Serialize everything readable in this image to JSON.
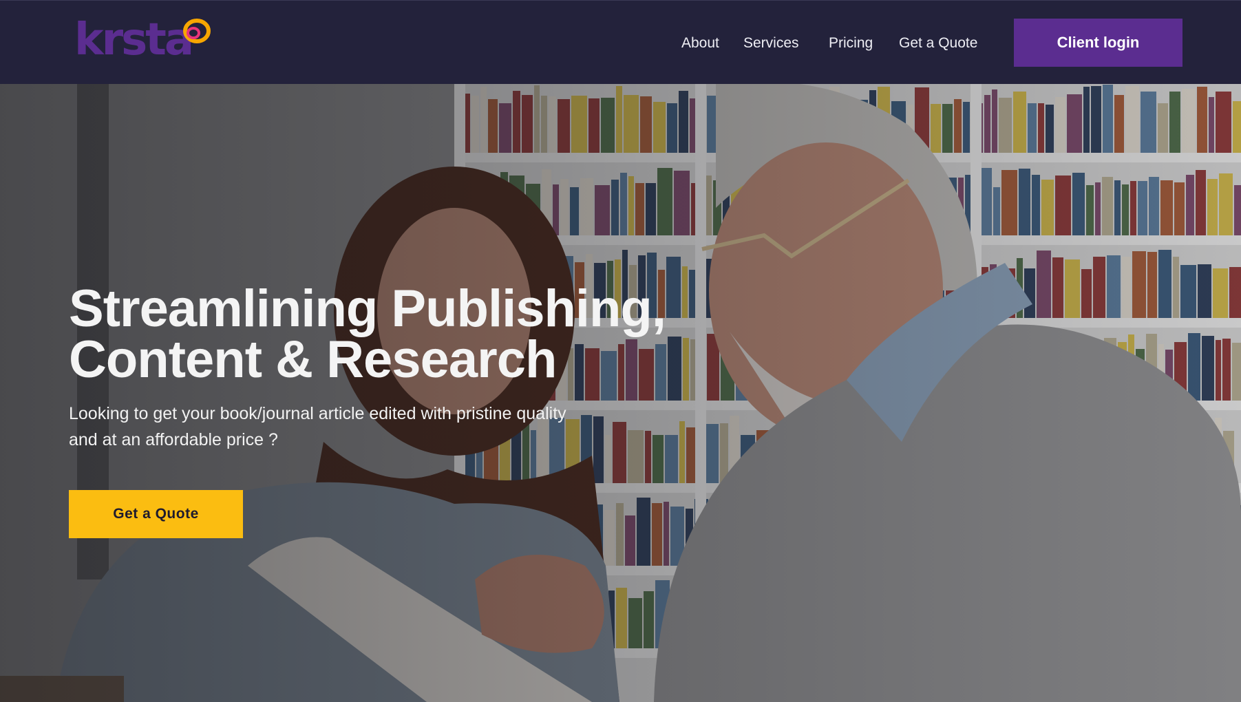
{
  "brand": {
    "name": "krsta",
    "colors": {
      "primary": "#5b2d90",
      "accent": "#fbbd11",
      "ring_outer": "#f7a600",
      "ring_inner": "#e9347a",
      "header_bg": "#23223b"
    }
  },
  "nav": {
    "items": [
      {
        "label": "About"
      },
      {
        "label": "Services"
      },
      {
        "label": "Pricing"
      },
      {
        "label": "Get a Quote"
      }
    ],
    "login_label": "Client login"
  },
  "hero": {
    "title_line1": "Streamlining Publishing,",
    "title_line2": "Content & Research",
    "subtitle": "Looking to get your book/journal article edited with pristine quality and at an affordable price ?",
    "cta_label": "Get a Quote"
  }
}
